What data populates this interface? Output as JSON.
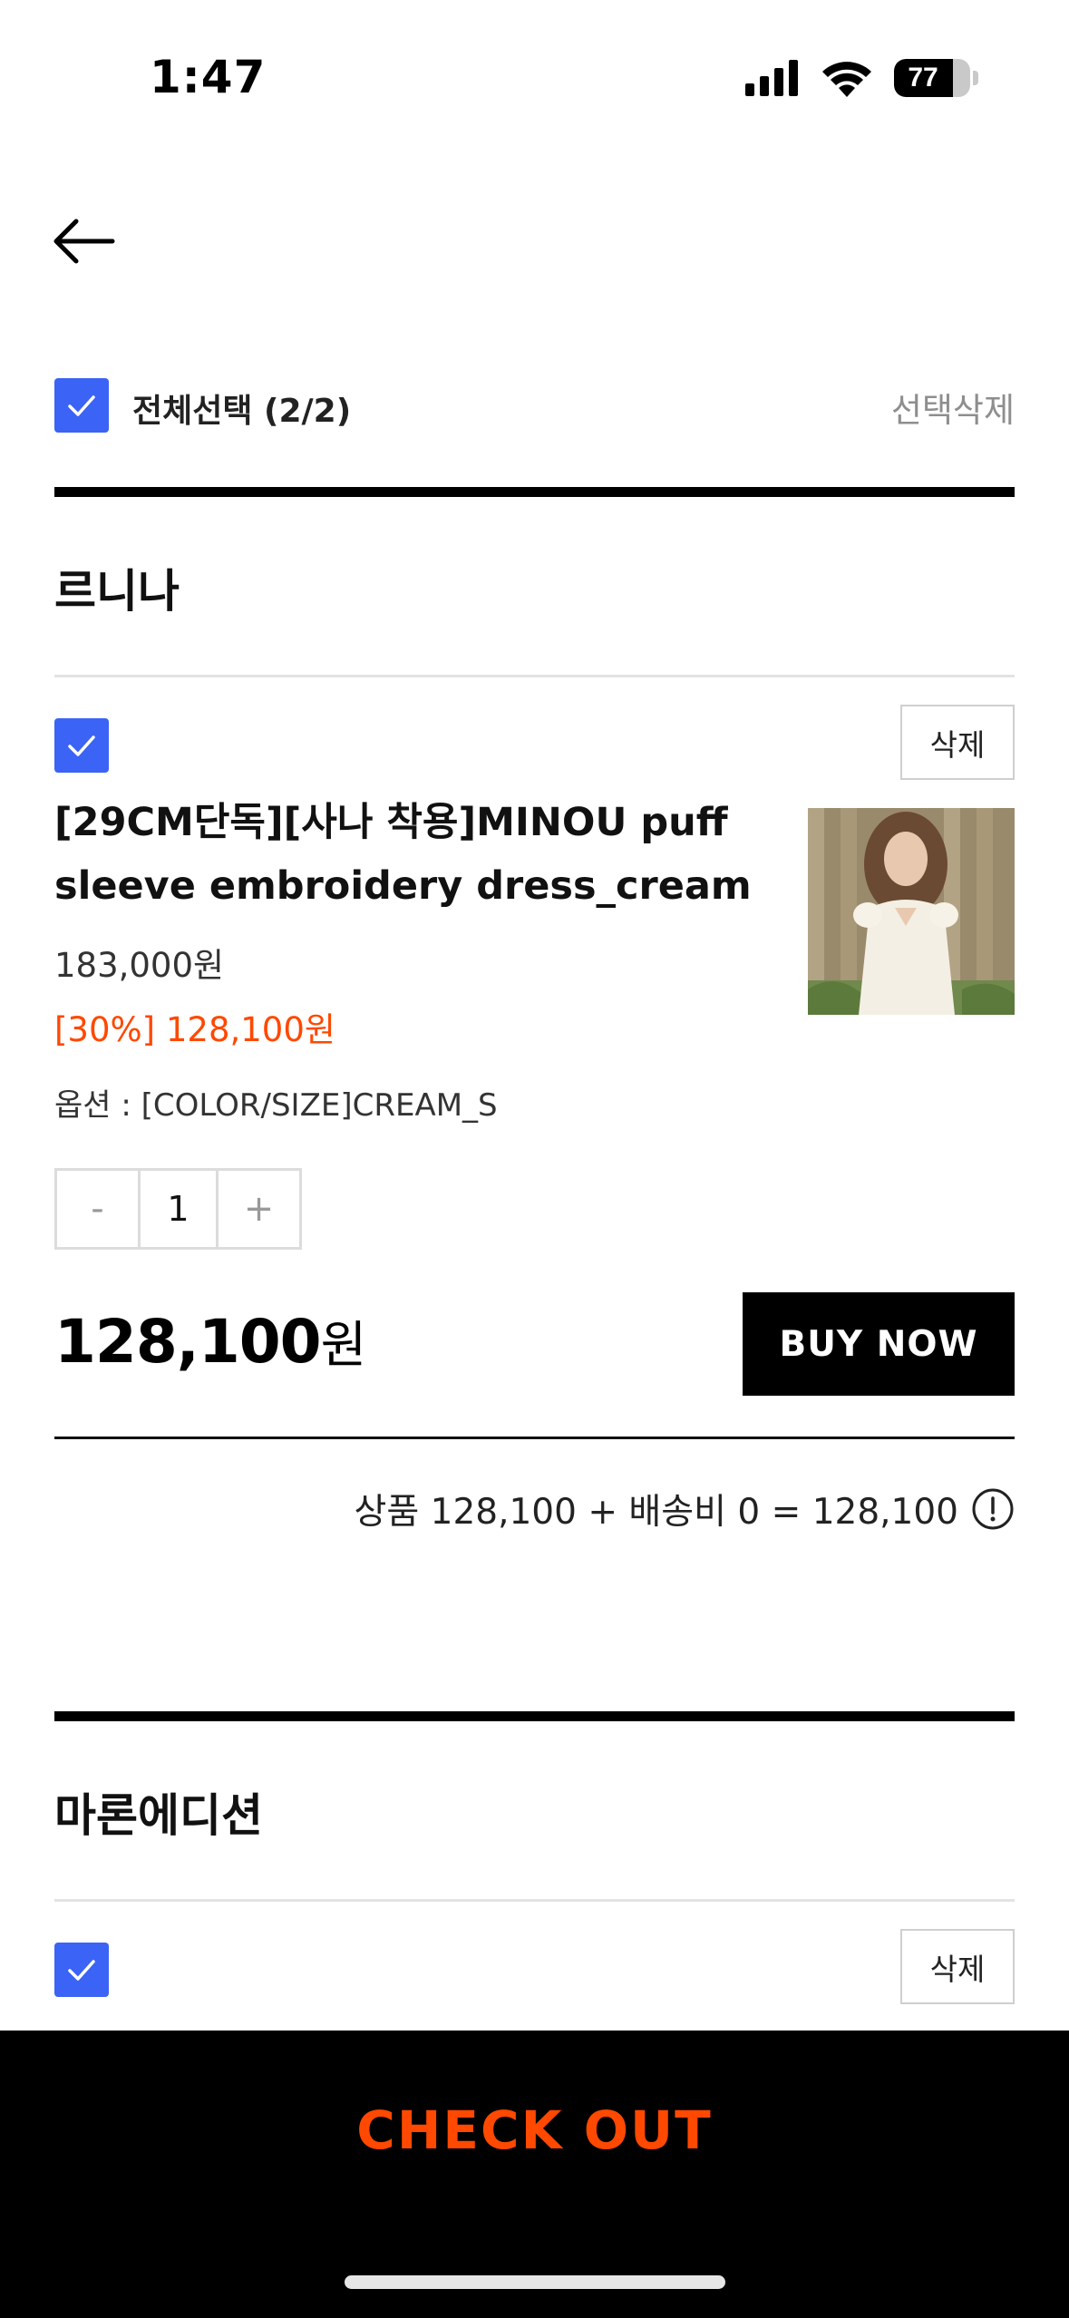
{
  "status_bar": {
    "time": "1:47",
    "battery": "77"
  },
  "cart": {
    "select_all_label": "전체선택 (2/2)",
    "delete_selected_label": "선택삭제",
    "groups": [
      {
        "brand": "르니나",
        "item": {
          "delete_label": "삭제",
          "title": "[29CM단독][사나 착용]MINOU puff sleeve embroidery dress_cream",
          "original_price": "183,000원",
          "sale_price": "[30%] 128,100원",
          "option": "옵션 : [COLOR/SIZE]CREAM_S",
          "quantity": "1",
          "minus": "-",
          "plus": "+",
          "total_number": "128,100",
          "total_unit": "원",
          "buy_now_label": "BUY NOW",
          "summary": "상품 128,100 + 배송비 0 = 128,100"
        }
      },
      {
        "brand": "마론에디션",
        "item": {
          "delete_label": "삭제"
        }
      }
    ]
  },
  "checkout_label": "CHECK OUT",
  "colors": {
    "accent": "#ff4800",
    "checkbox": "#3b63f5",
    "black": "#000000"
  }
}
